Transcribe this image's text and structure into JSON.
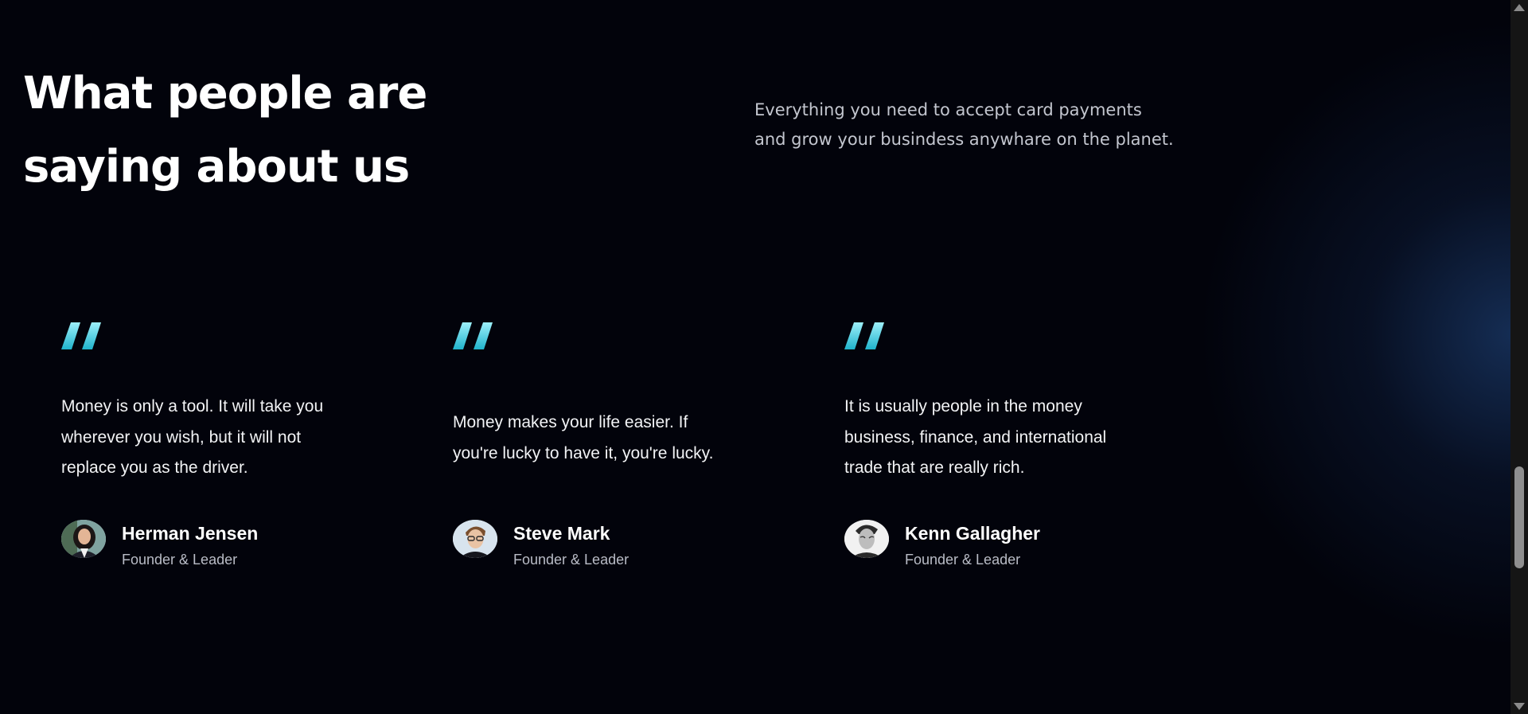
{
  "section": {
    "heading_line1": "What people are",
    "heading_line2": "saying about us",
    "intro_line1": "Everything you need to accept card payments",
    "intro_line2": "and grow your busindess anywhare on the planet."
  },
  "accent_colors": {
    "quote_gradient_start": "#8de8f5",
    "quote_gradient_end": "#1fb7cf"
  },
  "testimonials": [
    {
      "quote_icon": "quote-icon",
      "text": "Money is only a tool. It will take you wherever you wish, but it will not replace you as the driver.",
      "name": "Herman Jensen",
      "role": "Founder & Leader",
      "avatar": "avatar-photo"
    },
    {
      "quote_icon": "quote-icon",
      "text": "Money makes your life easier. If you're lucky to have it, you're lucky.",
      "name": "Steve Mark",
      "role": "Founder & Leader",
      "avatar": "avatar-photo"
    },
    {
      "quote_icon": "quote-icon",
      "text": "It is usually people in the money business, finance, and international trade that are really rich.",
      "name": "Kenn Gallagher",
      "role": "Founder & Leader",
      "avatar": "avatar-photo"
    }
  ]
}
